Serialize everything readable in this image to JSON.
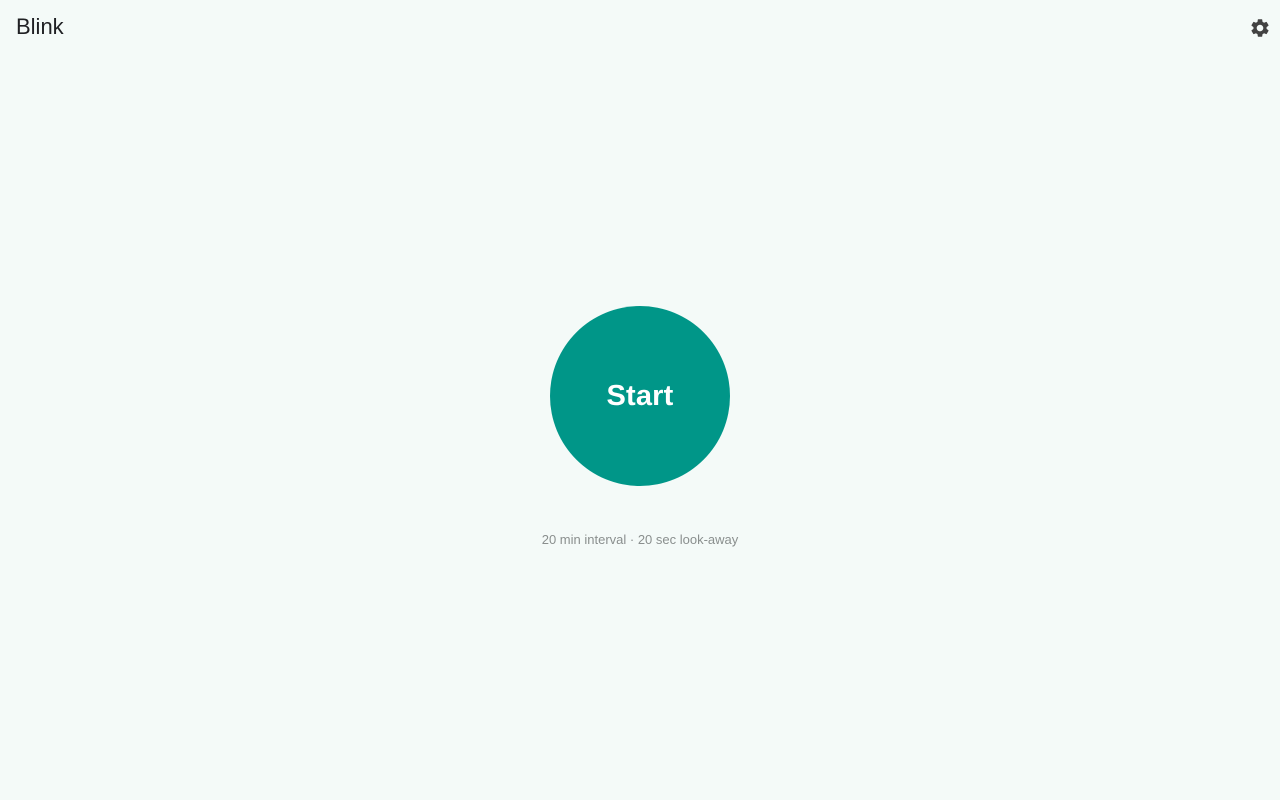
{
  "app": {
    "title": "Blink"
  },
  "toolbar": {
    "settings_icon": "gear-icon"
  },
  "timer": {
    "start_label": "Start",
    "summary": "20 min interval · 20 sec look-away"
  },
  "colors": {
    "accent": "#009688",
    "background": "#f4faf8",
    "title_text": "#202124",
    "muted_text": "#8a8f8e",
    "icon": "#424242"
  }
}
